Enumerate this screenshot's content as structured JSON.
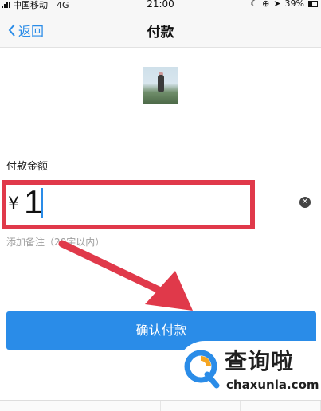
{
  "status_bar": {
    "carrier": "中国移动",
    "network": "4G",
    "time": "21:00",
    "battery": "39%"
  },
  "nav": {
    "back_label": "返回",
    "title": "付款"
  },
  "payment": {
    "amount_label": "付款金额",
    "currency_symbol": "¥",
    "amount_value": "1",
    "remark_placeholder": "添加备注（20字以内）",
    "confirm_label": "确认付款"
  },
  "watermark": {
    "title": "查询啦",
    "domain": "chaxunla.com"
  },
  "colors": {
    "accent_blue": "#2a8ce8",
    "highlight_red": "#e0394a"
  },
  "icons": {
    "back": "chevron-left-icon",
    "clear": "clear-circle-icon",
    "annotation_arrow": "red-arrow-icon"
  }
}
